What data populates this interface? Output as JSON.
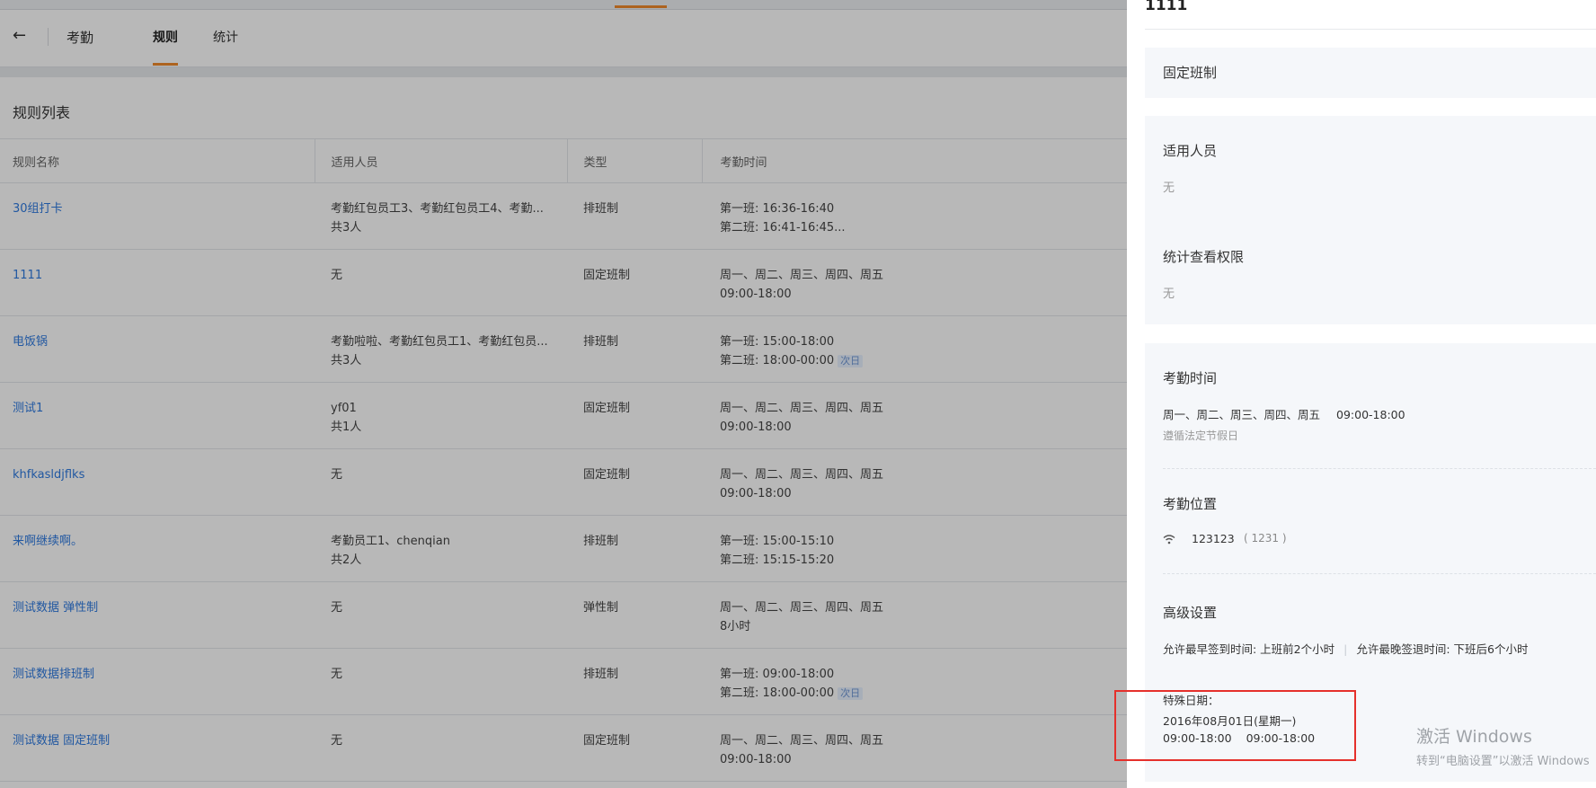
{
  "nav": {
    "back_icon": "←",
    "app_title": "考勤",
    "tabs": [
      {
        "label": "规则",
        "active": true
      },
      {
        "label": "统计",
        "active": false
      }
    ]
  },
  "rules_list": {
    "title": "规则列表",
    "columns": [
      "规则名称",
      "适用人员",
      "类型",
      "考勤时间"
    ],
    "rows": [
      {
        "name": "30组打卡",
        "people": "考勤红包员工3、考勤红包员工4、考勤...",
        "people_count": "共3人",
        "type": "排班制",
        "time_line1": "第一班: 16:36-16:40",
        "time_line2": "第二班: 16:41-16:45...",
        "tag": ""
      },
      {
        "name": "1111",
        "people": "无",
        "people_count": "",
        "type": "固定班制",
        "time_line1": "周一、周二、周三、周四、周五",
        "time_line2": "09:00-18:00",
        "tag": ""
      },
      {
        "name": "电饭锅",
        "people": "考勤啦啦、考勤红包员工1、考勤红包员...",
        "people_count": "共3人",
        "type": "排班制",
        "time_line1": "第一班: 15:00-18:00",
        "time_line2": "第二班: 18:00-00:00",
        "tag": "次日"
      },
      {
        "name": "测试1",
        "people": "yf01",
        "people_count": "共1人",
        "type": "固定班制",
        "time_line1": "周一、周二、周三、周四、周五",
        "time_line2": "09:00-18:00",
        "tag": ""
      },
      {
        "name": "khfkasldjflks",
        "people": "无",
        "people_count": "",
        "type": "固定班制",
        "time_line1": "周一、周二、周三、周四、周五",
        "time_line2": "09:00-18:00",
        "tag": ""
      },
      {
        "name": "来啊继续啊。",
        "people": "考勤员工1、chenqian",
        "people_count": "共2人",
        "type": "排班制",
        "time_line1": "第一班: 15:00-15:10",
        "time_line2": "第二班: 15:15-15:20",
        "tag": ""
      },
      {
        "name": "测试数据 弹性制",
        "people": "无",
        "people_count": "",
        "type": "弹性制",
        "time_line1": "周一、周二、周三、周四、周五",
        "time_line2": "8小时",
        "tag": ""
      },
      {
        "name": "测试数据排班制",
        "people": "无",
        "people_count": "",
        "type": "排班制",
        "time_line1": "第一班: 09:00-18:00",
        "time_line2": "第二班: 18:00-00:00",
        "tag": "次日"
      },
      {
        "name": "测试数据 固定班制",
        "people": "无",
        "people_count": "",
        "type": "固定班制",
        "time_line1": "周一、周二、周三、周四、周五",
        "time_line2": "09:00-18:00",
        "tag": ""
      }
    ]
  },
  "drawer": {
    "title": "1111",
    "shift_type": "固定班制",
    "applicable_label": "适用人员",
    "applicable_value": "无",
    "permission_label": "统计查看权限",
    "permission_value": "无",
    "attendance_time_label": "考勤时间",
    "attendance_days": "周一、周二、周三、周四、周五",
    "attendance_hours": "09:00-18:00",
    "holiday_note": "遵循法定节假日",
    "location_label": "考勤位置",
    "location_icon": "wifi-icon",
    "location_name": "123123",
    "location_code": "( 1231 )",
    "advanced_label": "高级设置",
    "earliest_checkin": "允许最早签到时间: 上班前2个小时",
    "latest_checkout": "允许最晚签退时间: 下班后6个小时",
    "special_label": "特殊日期：",
    "special_date": "2016年08月01日(星期一)",
    "special_time_1": "09:00-18:00",
    "special_time_2": "09:00-18:00"
  },
  "watermark": {
    "line1": "激活 Windows",
    "line2": "转到“电脑设置”以激活 Windows"
  },
  "colors": {
    "accent": "#f08a2c",
    "link": "#2f7ae0",
    "highlight_box": "#e5302b",
    "card_bg": "#f5f7fa"
  }
}
